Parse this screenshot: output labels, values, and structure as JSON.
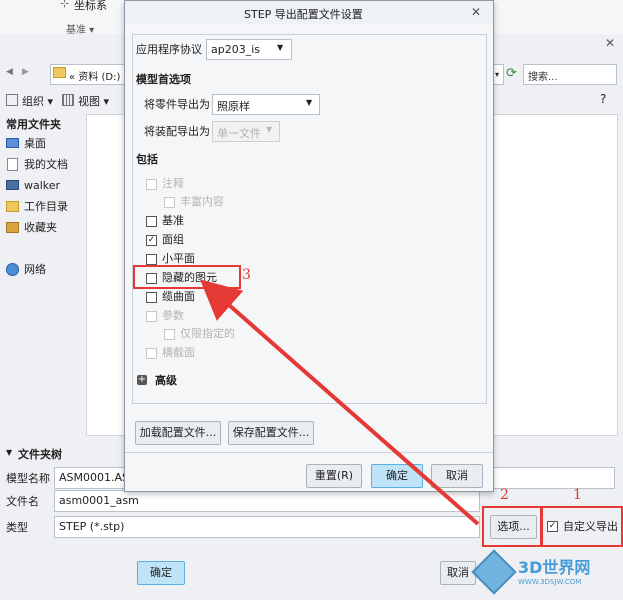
{
  "top_strip": {
    "label": "坐标系",
    "sublabel": "基准 ▾"
  },
  "file_dialog": {
    "close_glyph": "✕",
    "nav": {
      "back": "◀",
      "forward": "▶",
      "path": "« 资料 (D:)",
      "search_placeholder": "搜索..."
    },
    "toolbar": {
      "organize": "组织 ▾",
      "view": "视图 ▾",
      "help": "?"
    },
    "favorites": {
      "heading": "常用文件夹",
      "items": [
        "桌面",
        "我的文档",
        "walker",
        "工作目录",
        "收藏夹"
      ],
      "network": "网络"
    },
    "folder_tree": "文件夹树",
    "fields": {
      "model_name_label": "模型名称",
      "model_name_value": "ASM0001.ASM",
      "file_name_label": "文件名",
      "file_name_value": "asm0001_asm",
      "type_label": "类型",
      "type_value": "STEP (*.stp)"
    },
    "options_button": "选项...",
    "custom_export_label": "自定义导出",
    "ok_button": "确定",
    "cancel_button": "取消"
  },
  "step_dialog": {
    "title": "STEP 导出配置文件设置",
    "close_glyph": "✕",
    "protocol_label": "应用程序协议",
    "protocol_value": "ap203_is",
    "model_prefs_heading": "模型首选项",
    "part_export_label": "将零件导出为",
    "part_export_value": "照原样",
    "assembly_export_label": "将装配导出为",
    "assembly_export_value": "单一文件",
    "include_heading": "包括",
    "include_items": [
      {
        "label": "注释",
        "checked": false,
        "enabled": false
      },
      {
        "label": "丰富内容",
        "checked": false,
        "enabled": false
      },
      {
        "label": "基准",
        "checked": false,
        "enabled": true
      },
      {
        "label": "面组",
        "checked": true,
        "enabled": true
      },
      {
        "label": "小平面",
        "checked": false,
        "enabled": true
      },
      {
        "label": "隐藏的图元",
        "checked": false,
        "enabled": true
      },
      {
        "label": "缆曲面",
        "checked": false,
        "enabled": true
      },
      {
        "label": "参数",
        "checked": false,
        "enabled": false
      },
      {
        "label": "仅限指定的",
        "checked": false,
        "enabled": false
      },
      {
        "label": "横截面",
        "checked": false,
        "enabled": false
      }
    ],
    "advanced_label": "高级",
    "load_config_button": "加载配置文件...",
    "save_config_button": "保存配置文件...",
    "reset_button": "重置(R)",
    "ok_button": "确定",
    "cancel_button": "取消"
  },
  "annotations": {
    "n1": "1",
    "n2": "2",
    "n3": "3",
    "color": "#e53935"
  },
  "watermark": {
    "brand": "3D世界网",
    "url": "WWW.3DSJW.COM"
  }
}
